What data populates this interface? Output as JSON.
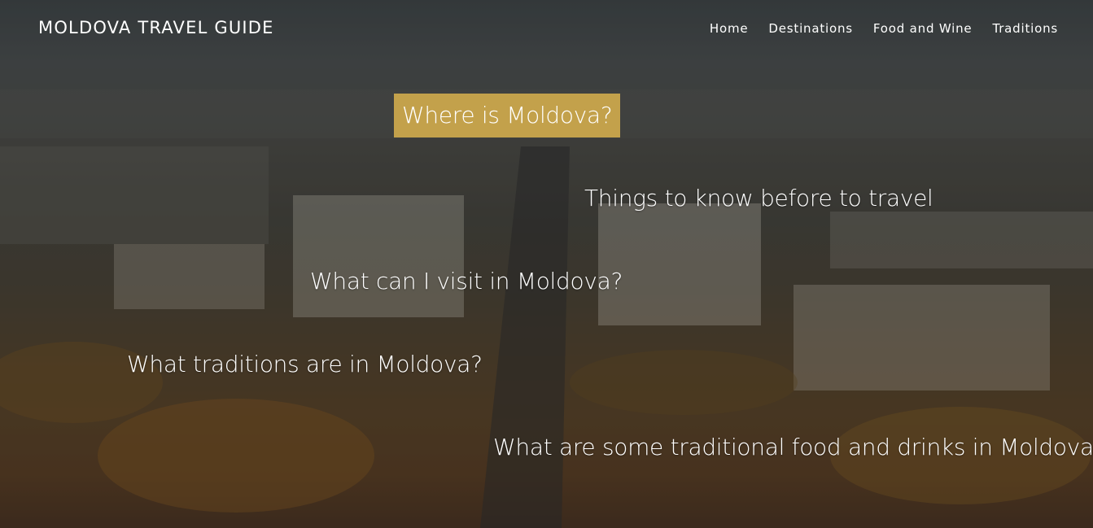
{
  "header": {
    "brand": "MOLDOVA TRAVEL GUIDE",
    "nav": [
      "Home",
      "Destinations",
      "Food and Wine",
      "Traditions"
    ]
  },
  "questions": {
    "active": "Where is Moldova?",
    "items": [
      "Things to know before to travel",
      "What can I visit in Moldova?",
      "What traditions are in Moldova?",
      "What are some traditional food and drinks in Moldova?"
    ]
  },
  "colors": {
    "accent": "#c3a14b",
    "text": "#ffffff"
  }
}
